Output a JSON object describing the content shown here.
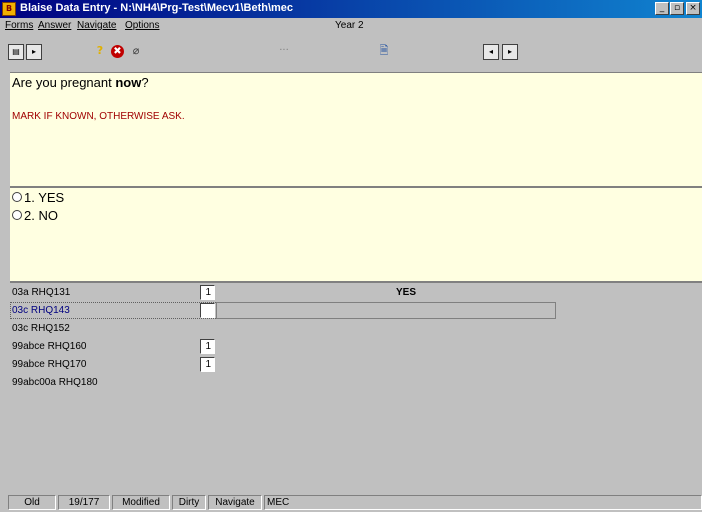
{
  "window": {
    "title": "Blaise Data Entry - N:\\NH4\\Prg-Test\\Mecv1\\Beth\\mec",
    "app_icon": "blaise-app-icon"
  },
  "menu": {
    "forms": "Forms",
    "answer": "Answer",
    "navigate": "Navigate",
    "options": "Options",
    "context": "Year 2"
  },
  "toolbar": {
    "dots": "···"
  },
  "question": {
    "prefix": "Are you pregnant ",
    "emphasis": "now",
    "suffix": "?",
    "instruction": "MARK IF KNOWN, OTHERWISE ASK."
  },
  "answers": [
    {
      "label": "1. YES"
    },
    {
      "label": "2. NO"
    }
  ],
  "grid": {
    "rows": [
      {
        "label": "03a RHQ131",
        "value": "1",
        "text": "YES"
      },
      {
        "label": "03c RHQ143",
        "value": "",
        "text": ""
      },
      {
        "label": "03c RHQ152",
        "value": "",
        "text": ""
      },
      {
        "label": "99abce RHQ160",
        "value": "1",
        "text": ""
      },
      {
        "label": "99abce RHQ170",
        "value": "1",
        "text": ""
      },
      {
        "label": "99abc00a RHQ180",
        "value": "",
        "text": ""
      }
    ]
  },
  "status": {
    "mode": "Old",
    "position": "19/177",
    "modified": "Modified",
    "dirty": "Dirty",
    "navigate": "Navigate",
    "station": "MEC"
  },
  "colors": {
    "titlebar": "#000080",
    "pane_bg": "#ffffe1",
    "instruction": "#a00000",
    "active_row": "#000080"
  }
}
